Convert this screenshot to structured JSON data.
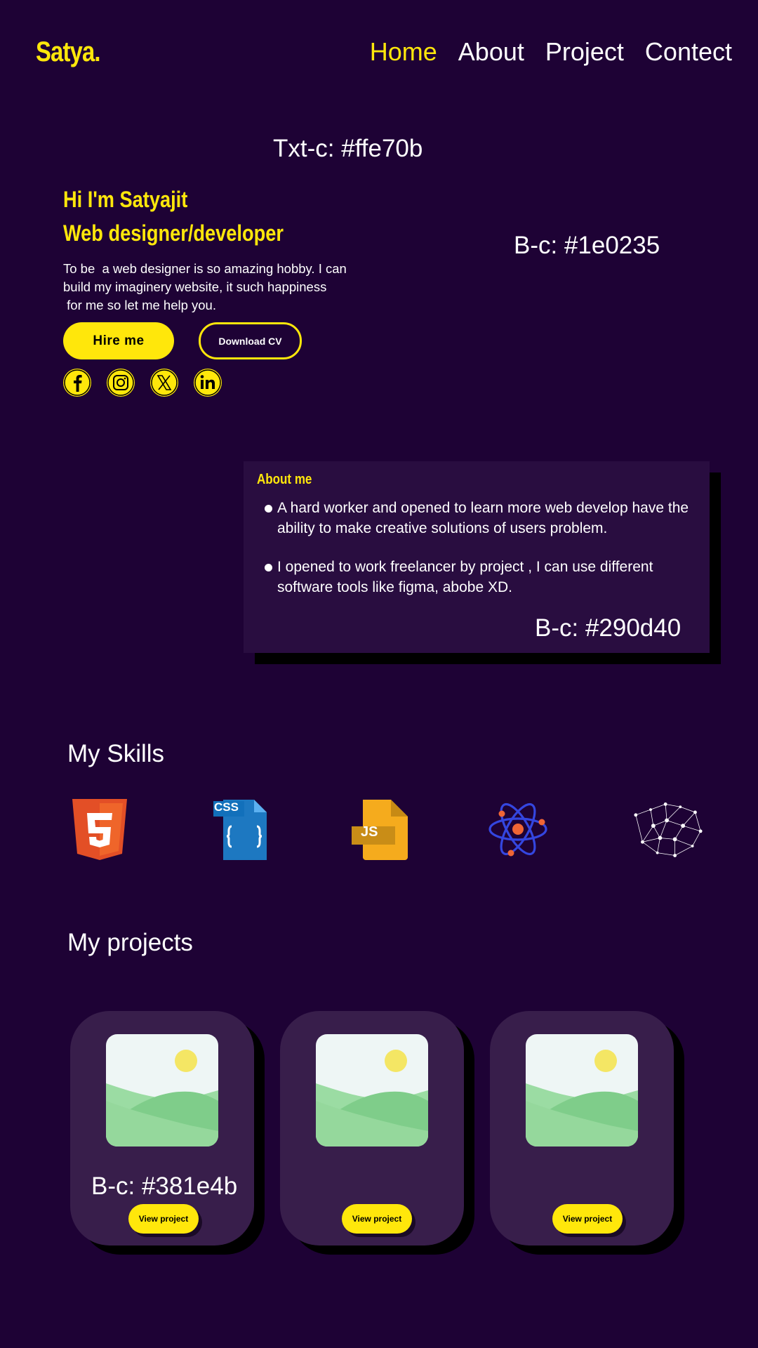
{
  "header": {
    "logo": "Satya.",
    "nav": [
      {
        "label": "Home",
        "active": true
      },
      {
        "label": "About",
        "active": false
      },
      {
        "label": "Project",
        "active": false
      },
      {
        "label": "Contect",
        "active": false
      }
    ]
  },
  "notes": {
    "text_color": "Txt-c: #ffe70b",
    "bg_color": "B-c: #1e0235",
    "about_bg": "B-c: #290d40",
    "card_bg": "B-c: #381e4b"
  },
  "hero": {
    "greeting": "Hi I'm Satyajit",
    "role": "Web designer/developer",
    "description_lines": [
      "To be  a web designer is so amazing hobby. I can",
      "build my imaginery website, it such happiness",
      " for me so let me help you."
    ],
    "hire_button": "Hire me",
    "cv_button": "Download CV",
    "socials": [
      "facebook-icon",
      "instagram-icon",
      "x-icon",
      "linkedin-icon"
    ]
  },
  "about": {
    "title": "About me",
    "items": [
      {
        "line1": "A hard worker  and opened to learn more web develop have the",
        "line2": "ability to make creative solutions of users problem."
      },
      {
        "line1": "I opened to work freelancer by project , I can use different",
        "line2": "software tools like figma, abobe XD."
      }
    ]
  },
  "skills": {
    "title": "My Skills",
    "icons": [
      "html5-icon",
      "css-file-icon",
      "js-file-icon",
      "react-icon",
      "network-icon"
    ],
    "css_label": "CSS",
    "js_label": "JS"
  },
  "projects": {
    "title": "My projects",
    "cards": [
      {
        "button": "View project"
      },
      {
        "button": "View project"
      },
      {
        "button": "View project"
      }
    ]
  },
  "colors": {
    "accent": "#ffe70b",
    "background": "#1e0235",
    "about_bg": "#290d40",
    "card_bg": "#381e4b"
  }
}
